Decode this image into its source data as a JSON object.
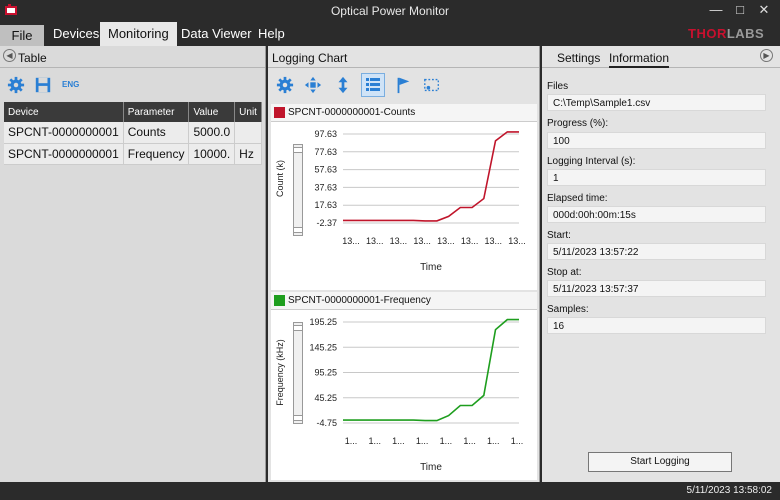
{
  "window": {
    "title": "Optical Power Monitor",
    "minimize": "—",
    "maximize": "□",
    "close": "✕"
  },
  "menu": {
    "file": "File",
    "devices": "Devices",
    "monitoring": "Monitoring",
    "data_viewer": "Data Viewer",
    "help": "Help"
  },
  "logo": {
    "part1": "THOR",
    "part2": "LABS"
  },
  "left_panel": {
    "title": "Table",
    "toolbar": {
      "settings_icon": "gear-icon",
      "save_icon": "save-icon",
      "language_label": "ENG"
    },
    "columns": [
      "Device",
      "Parameter",
      "Value",
      "Unit"
    ],
    "rows": [
      [
        "SPCNT-0000000001",
        "Counts",
        "5000.0",
        ""
      ],
      [
        "SPCNT-0000000001",
        "Frequency",
        "10000.",
        "Hz"
      ]
    ]
  },
  "middle_panel": {
    "title": "Logging Chart",
    "toolbar": [
      "gear-icon",
      "move-icon",
      "vertical-arrows-icon",
      "table-icon",
      "flag-icon",
      "select-region-icon"
    ]
  },
  "chart_data": [
    {
      "type": "line",
      "legend": "SPCNT-0000000001-Counts",
      "color": "#c0152b",
      "xlabel": "Time",
      "ylabel": "Count (k)",
      "x_ticks": [
        "13...",
        "13...",
        "13...",
        "13...",
        "13...",
        "13...",
        "13...",
        "13..."
      ],
      "y_ticks": [
        "97.63",
        "77.63",
        "57.63",
        "37.63",
        "17.63",
        "-2.37"
      ],
      "ylim": [
        -2.37,
        97.63
      ],
      "x": [
        0,
        1,
        2,
        3,
        4,
        5,
        6,
        7,
        8,
        9,
        10,
        11,
        12,
        13,
        14,
        15
      ],
      "y": [
        0.5,
        0.5,
        0.5,
        0.5,
        0.5,
        0.5,
        0.5,
        0,
        0,
        5,
        15,
        15,
        25,
        90,
        100,
        100
      ]
    },
    {
      "type": "line",
      "legend": "SPCNT-0000000001-Frequency",
      "color": "#1e9e1e",
      "xlabel": "Time",
      "ylabel": "Frequency (kHz)",
      "x_ticks": [
        "1...",
        "1...",
        "1...",
        "1...",
        "1...",
        "1...",
        "1...",
        "1..."
      ],
      "y_ticks": [
        "195.25",
        "145.25",
        "95.25",
        "45.25",
        "-4.75"
      ],
      "ylim": [
        -4.75,
        195.25
      ],
      "x": [
        0,
        1,
        2,
        3,
        4,
        5,
        6,
        7,
        8,
        9,
        10,
        11,
        12,
        13,
        14,
        15
      ],
      "y": [
        1,
        1,
        1,
        1,
        1,
        1,
        1,
        0,
        0,
        10,
        30,
        30,
        50,
        180,
        200,
        200
      ]
    }
  ],
  "right_panel": {
    "tabs": [
      "Settings",
      "Information"
    ],
    "fields": [
      {
        "label": "Files",
        "value": "C:\\Temp\\Sample1.csv"
      },
      {
        "label": "Progress (%):",
        "value": "100"
      },
      {
        "label": "Logging Interval (s):",
        "value": "1"
      },
      {
        "label": "Elapsed time:",
        "value": "000d:00h:00m:15s"
      },
      {
        "label": "Start:",
        "value": "5/11/2023 13:57:22"
      },
      {
        "label": "Stop at:",
        "value": "5/11/2023 13:57:37"
      },
      {
        "label": "Samples:",
        "value": "16"
      }
    ],
    "start_button": "Start Logging"
  },
  "status": {
    "time": "5/11/2023 13:58:02"
  }
}
